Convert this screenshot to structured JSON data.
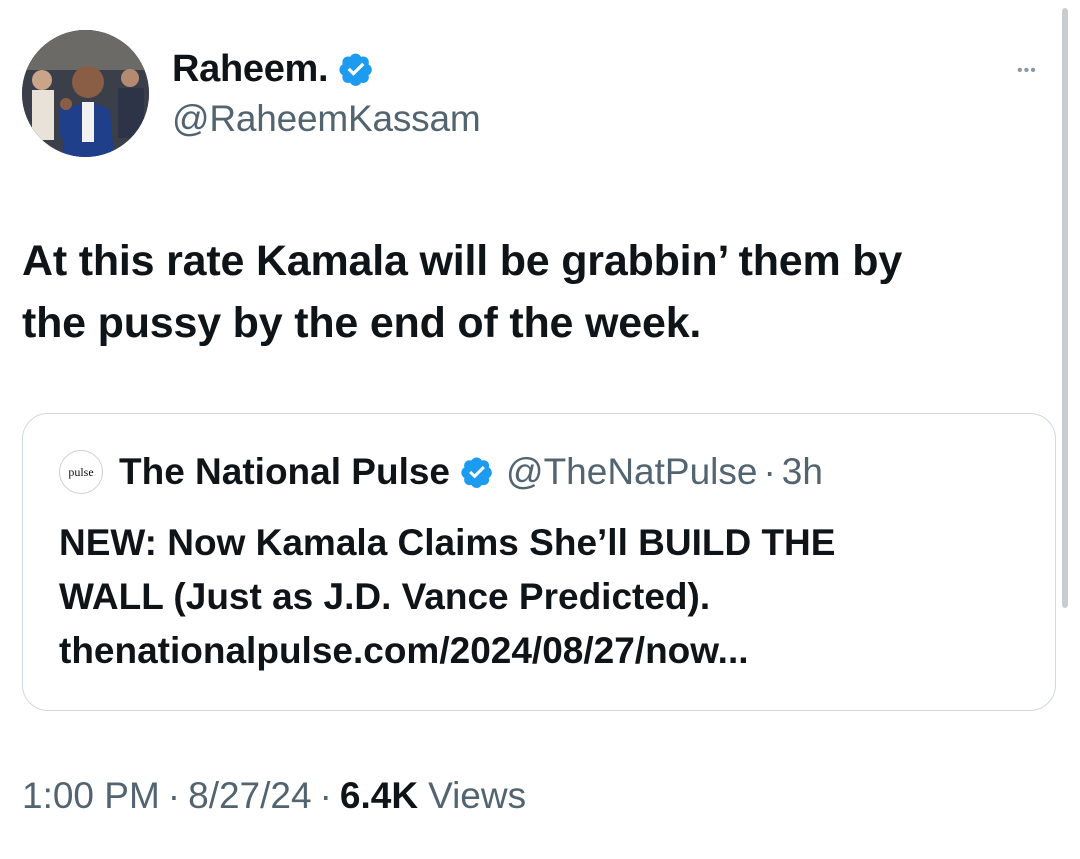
{
  "author": {
    "display_name": "Raheem.",
    "handle": "@RaheemKassam",
    "avatar_icon": "profile-photo",
    "verified_color": "#1d9bf0"
  },
  "more_menu": {
    "label": "•••"
  },
  "tweet": {
    "text_lines": [
      "At this rate Kamala will be grabbin’ them by",
      "the pussy by the end of the week."
    ]
  },
  "quote": {
    "avatar_label": "pulse",
    "name": "The National Pulse",
    "handle": "@TheNatPulse",
    "separator": "·",
    "time": "3h",
    "body_lines": [
      "NEW: Now Kamala Claims She’ll BUILD THE",
      "WALL (Just as J.D. Vance Predicted).",
      "thenationalpulse.com/2024/08/27/now..."
    ]
  },
  "meta": {
    "time": "1:00 PM",
    "separator": "·",
    "date": "8/27/24",
    "views_count": "6.4K",
    "views_label": "Views"
  }
}
